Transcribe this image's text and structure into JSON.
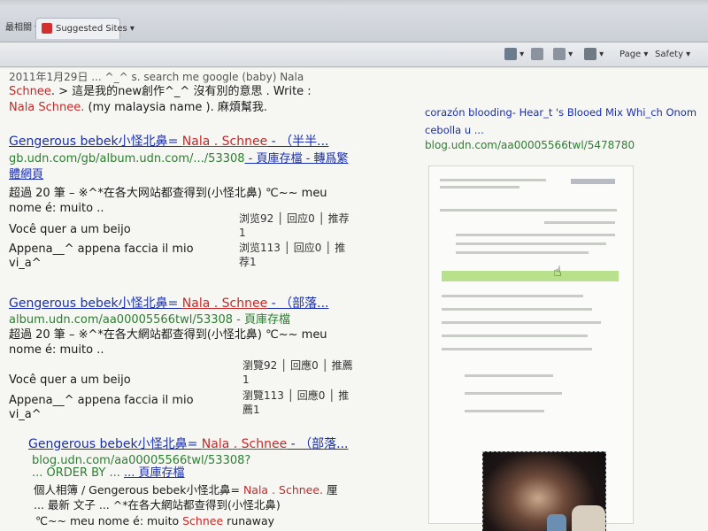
{
  "browser": {
    "tab1_label": "最相關 ▾",
    "tab2_label": "Suggested Sites ▾",
    "toolbar": {
      "page_label": "Page ▾",
      "safety_label": "Safety ▾"
    }
  },
  "results": [
    {
      "header_line1": "2011年1月29日 ... ^_^ s. search me google (baby) Nala",
      "header_line2_red": "Schnee",
      "header_line2_rest": ". > 這是我的new創作^_^ 沒有別的意思 . Write :",
      "header_line3_red": "Nala Schnee.",
      "header_line3_rest": " (my malaysia name ). 麻煩幫我."
    },
    {
      "title_a": "Gengerous bebek小怪北鼻= ",
      "title_b": "Nala . Schnee",
      "title_c": " - （半半...",
      "url": "gb.udn.com/gb/album.udn.com/.../53308",
      "url_extra": " - 頁庫存檔 - 轉爲繁",
      "url_extra2": "體網頁",
      "snippet1": "超過 20 筆 – ※^*在各大网站都查得到(小怪北鼻) ℃~~ meu",
      "snippet2": "nome é: muito ..",
      "row1": "Você quer a um beijo",
      "row2": "Appena__^ appena faccia il mio",
      "row3": "vi_a^",
      "stat1": "浏览92 │ 回应0 │ 推荐",
      "stat1b": "1",
      "stat2": "浏览113 │ 回应0 │ 推",
      "stat2b": "荐1"
    },
    {
      "title_a": "Gengerous bebek小怪北鼻= ",
      "title_b": "Nala . Schnee",
      "title_c": " - （部落...",
      "url": "album.udn.com/aa00005566twl/53308 - 頁庫存檔",
      "snippet1": "超過 20 筆 – ※^*在各大網站都查得到(小怪北鼻) ℃~~ meu",
      "snippet2": "nome é: muito ..",
      "row1": "Você quer a um beijo",
      "row2": "Appena__^ appena faccia il mio",
      "row3": "vi_a^",
      "stat1": "瀏覽92 │ 回應0 │ 推薦",
      "stat1b": "1",
      "stat2": "瀏覽113 │ 回應0 │ 推",
      "stat2b": "薦1"
    },
    {
      "title_a": "Gengerous bebek小怪北鼻= ",
      "title_b": "Nala . Schnee",
      "title_c": " - （部落...",
      "url": "blog.udn.com/aa00005566twl/53308?",
      "url_extra": "... 頁庫存檔",
      "snippet0": "... ORDER BY ...",
      "snippet1a": "個人相簿 / Gengerous bebek小怪北鼻= ",
      "snippet1b": "Nala . Schnee.",
      "snippet1c": " 厘",
      "snippet2": "... 最新 文子 ... ^*在各大網站都查得到(小怪北鼻)",
      "snippet3a": "℃~~ meu nome é: muito ",
      "snippet3b": "Schnee",
      "snippet3c": " runaway"
    }
  ],
  "sidebar": {
    "line1": "corazón blooding- Hear_t 's Blooed Mix Whi_ch Onom",
    "line2": "cebolla u ...",
    "line3": "blog.udn.com/aa00005566twl/5478780"
  },
  "colors": {
    "link": "#1a2fb0",
    "red": "#c62828",
    "url_green": "#2e7d32"
  }
}
